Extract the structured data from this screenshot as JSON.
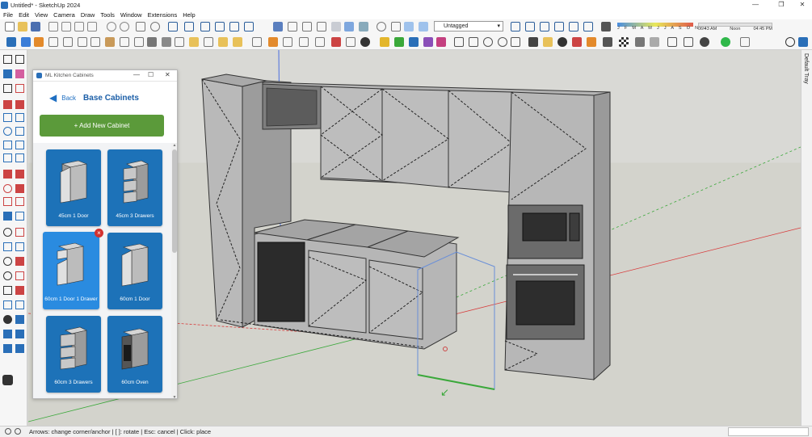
{
  "window": {
    "title": "Untitled* - SketchUp 2024",
    "min": "—",
    "restore": "❐",
    "close": "✕"
  },
  "menu": [
    "File",
    "Edit",
    "View",
    "Camera",
    "Draw",
    "Tools",
    "Window",
    "Extensions",
    "Help"
  ],
  "toolbar": {
    "tag_select": "Untagged",
    "shadow_months": "J F M A M J J A S O N D",
    "time_start": "06:43 AM",
    "time_mid": "Noon",
    "time_end": "04:45 PM"
  },
  "tray": {
    "label": "Default Tray"
  },
  "panel": {
    "title": "ML Kitchen Cabinets",
    "back_label": "Back",
    "section_title": "Base Cabinets",
    "add_button": "+ Add New Cabinet",
    "cards": [
      {
        "label": "45cm 1 Door",
        "type": "door"
      },
      {
        "label": "45cm 3 Drawers",
        "type": "drawers"
      },
      {
        "label": "60cm 1 Door 1 Drawer",
        "type": "door-drawer",
        "selected": true
      },
      {
        "label": "60cm 1 Door",
        "type": "door"
      },
      {
        "label": "60cm 3 Drawers",
        "type": "drawers"
      },
      {
        "label": "60cm Oven",
        "type": "oven"
      }
    ],
    "remove_badge": "×"
  },
  "status": {
    "hint": "Arrows: change corner/anchor | [ ]: rotate | Esc: cancel | Click: place"
  },
  "colors": {
    "accent": "#1d72b8",
    "add_button": "#5b9a3a",
    "remove": "#d3312f",
    "axis_red": "#d83a3a",
    "axis_green": "#3aa83a",
    "axis_blue": "#4a6ee0"
  }
}
